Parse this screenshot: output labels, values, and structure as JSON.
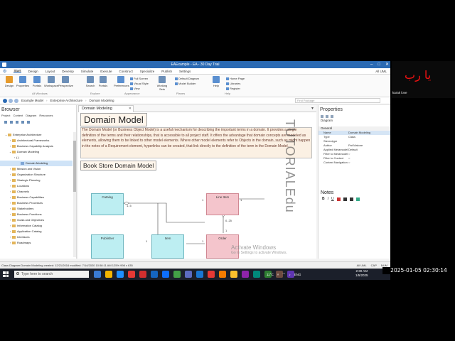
{
  "window": {
    "title": "EAExample - EA - 30 Day Trial",
    "controls": [
      "–",
      "□",
      "✕"
    ]
  },
  "ribbon": {
    "tabs": [
      "Start",
      "Design",
      "Layout",
      "Develop",
      "Simulate",
      "Execute",
      "Construct",
      "Specialize",
      "Publish",
      "Settings"
    ],
    "active_tab": "Start",
    "right_label": "All UML",
    "buttons": [
      {
        "label": "Design",
        "color": "#e69b2d"
      },
      {
        "label": "Properties",
        "color": "#5a8fd0"
      },
      {
        "label": "Portals",
        "color": "#5a8fd0"
      },
      {
        "label": "Workspace",
        "color": "#6c8fb8"
      },
      {
        "label": "Perspective",
        "color": "#6c8fb8"
      },
      {
        "label": "Search",
        "color": "#6c8fb8"
      },
      {
        "label": "Portals",
        "color": "#6c8fb8"
      },
      {
        "label": "Preferences",
        "color": "#5a8fd0"
      },
      {
        "label": "Working Sets",
        "color": "#6c8fb8"
      },
      {
        "label": "Help",
        "color": "#5a8fd0"
      }
    ],
    "small_items": [
      "Full Screen",
      "Visual Style",
      "View",
      "Default Diagram",
      "Model Builder",
      "Home Page",
      "Libraries",
      "Register"
    ],
    "groups": [
      "All Windows",
      "Explore",
      "Appearance",
      "Planes",
      "Help"
    ]
  },
  "address": {
    "crumbs": [
      "Example Model",
      "Enterprise Architecture",
      "Domain Modeling"
    ],
    "search_placeholder": "Find Package"
  },
  "browser": {
    "title": "Browser",
    "tabs": [
      "Project",
      "Context",
      "Diagram",
      "Resources"
    ],
    "tree": [
      {
        "label": "Enterprise Architecture",
        "indent": 1,
        "kind": "pkg",
        "exp": "⌄"
      },
      {
        "label": "Architectural Frameworks",
        "indent": 2,
        "kind": "pkg",
        "exp": "›"
      },
      {
        "label": "Business Capability Analysis",
        "indent": 2,
        "kind": "pkg",
        "exp": "›"
      },
      {
        "label": "Domain Modeling",
        "indent": 2,
        "kind": "pkg",
        "exp": "⌄"
      },
      {
        "label": "(.)",
        "indent": 3,
        "kind": "none",
        "exp": "›"
      },
      {
        "label": "Domain Modeling",
        "indent": 4,
        "kind": "diag",
        "exp": "",
        "selected": true
      },
      {
        "label": "Mission and Vision",
        "indent": 2,
        "kind": "pkg",
        "exp": "›"
      },
      {
        "label": "Organization Structure",
        "indent": 2,
        "kind": "pkg",
        "exp": "›"
      },
      {
        "label": "Strategic Planning",
        "indent": 2,
        "kind": "pkg",
        "exp": "›"
      },
      {
        "label": "Locations",
        "indent": 2,
        "kind": "pkg",
        "exp": "›"
      },
      {
        "label": "Channels",
        "indent": 2,
        "kind": "pkg",
        "exp": "›"
      },
      {
        "label": "Business Capabilities",
        "indent": 2,
        "kind": "pkg",
        "exp": "›"
      },
      {
        "label": "Business Processes",
        "indent": 2,
        "kind": "pkg",
        "exp": "›"
      },
      {
        "label": "Stakeholders",
        "indent": 2,
        "kind": "pkg",
        "exp": "›"
      },
      {
        "label": "Business Functions",
        "indent": 2,
        "kind": "pkg",
        "exp": "›"
      },
      {
        "label": "Goals and Objectives",
        "indent": 2,
        "kind": "pkg",
        "exp": "›"
      },
      {
        "label": "Information Catalog",
        "indent": 2,
        "kind": "pkg",
        "exp": "›"
      },
      {
        "label": "Application Catalog",
        "indent": 2,
        "kind": "pkg",
        "exp": "›"
      },
      {
        "label": "Interfaces",
        "indent": 2,
        "kind": "pkg",
        "exp": "›"
      },
      {
        "label": "Roadmaps",
        "indent": 2,
        "kind": "pkg",
        "exp": "›"
      }
    ]
  },
  "diagram": {
    "tab_label": "Domain Modeling",
    "header_crumbs": "Domain Modeling · Class Diagram",
    "title": "Domain Model",
    "description": "The Domain Model (or Business Object Model) is a useful mechanism for describing the important terms in a domain. It provides a single definition of the terms and their relationships, that is accessible to all project staff. It offers the advantage that domain concepts are modeled as elements, allowing them to be linked to other model elements. Where other model elements refer to Objects in the domain, such as might happen in the notes of a Requirement element, hyperlinks can be created, that link directly to the definition of the term in the Domain Model.",
    "subtitle": "Book Store Domain Model",
    "classes": {
      "catalog": "Catalog",
      "line_item": "Line Item",
      "publisher": "Publisher",
      "item": "Item",
      "order": "Order"
    },
    "multiplicities": [
      "1..5",
      "1",
      "1",
      "0..25",
      "1",
      "1",
      "1"
    ],
    "watermark": "TUTORIALEdu",
    "activate_title": "Activate Windows",
    "activate_sub": "Go to Settings to activate Windows."
  },
  "properties": {
    "title": "Properties",
    "subtitle": "Diagram",
    "group": "General",
    "rows": [
      {
        "k": "Name",
        "v": "Domain Modeling"
      },
      {
        "k": "Type",
        "v": "Class"
      },
      {
        "k": "Stereotype",
        "v": ""
      },
      {
        "k": "Author",
        "v": "Pat Malone"
      },
      {
        "k": "Applied Metamodel",
        "v": "Default"
      },
      {
        "k": "Filter to Metamodel",
        "v": "○"
      },
      {
        "k": "Filter to Context",
        "v": "○"
      },
      {
        "k": "Context Navigation",
        "v": "○"
      }
    ],
    "notes_title": "Notes",
    "notes_tools": [
      "B",
      "I",
      "U"
    ]
  },
  "status": {
    "left": "Class Diagram:Domain Modeling   created: 12/21/2016  modified: 7/14/2020 10:58:11 AM   125%   998 x 635",
    "right": [
      "All UML",
      "CAP",
      "NUM"
    ]
  },
  "taskbar": {
    "search_placeholder": "Type here to search",
    "icon_colors": [
      "#3a7bd5",
      "#f4b400",
      "#1e90ff",
      "#e53935",
      "#d32f2f",
      "#1565c0",
      "#0d6efd",
      "#43a047",
      "#5c6bc0",
      "#1976d2",
      "#e53935",
      "#f57c00",
      "#fbc02d",
      "#8e24aa",
      "#00897b",
      "#2e7d32",
      "#6d4c41",
      "#5e35b1"
    ],
    "weather": "11°C",
    "lang": "ENG",
    "time": "2:30 AM",
    "date": "1/5/2025"
  },
  "overlay": {
    "timestamp": "2025-01-05 02:30:14",
    "thumb_text": "يا رب",
    "thumb_caption": "karak love"
  }
}
